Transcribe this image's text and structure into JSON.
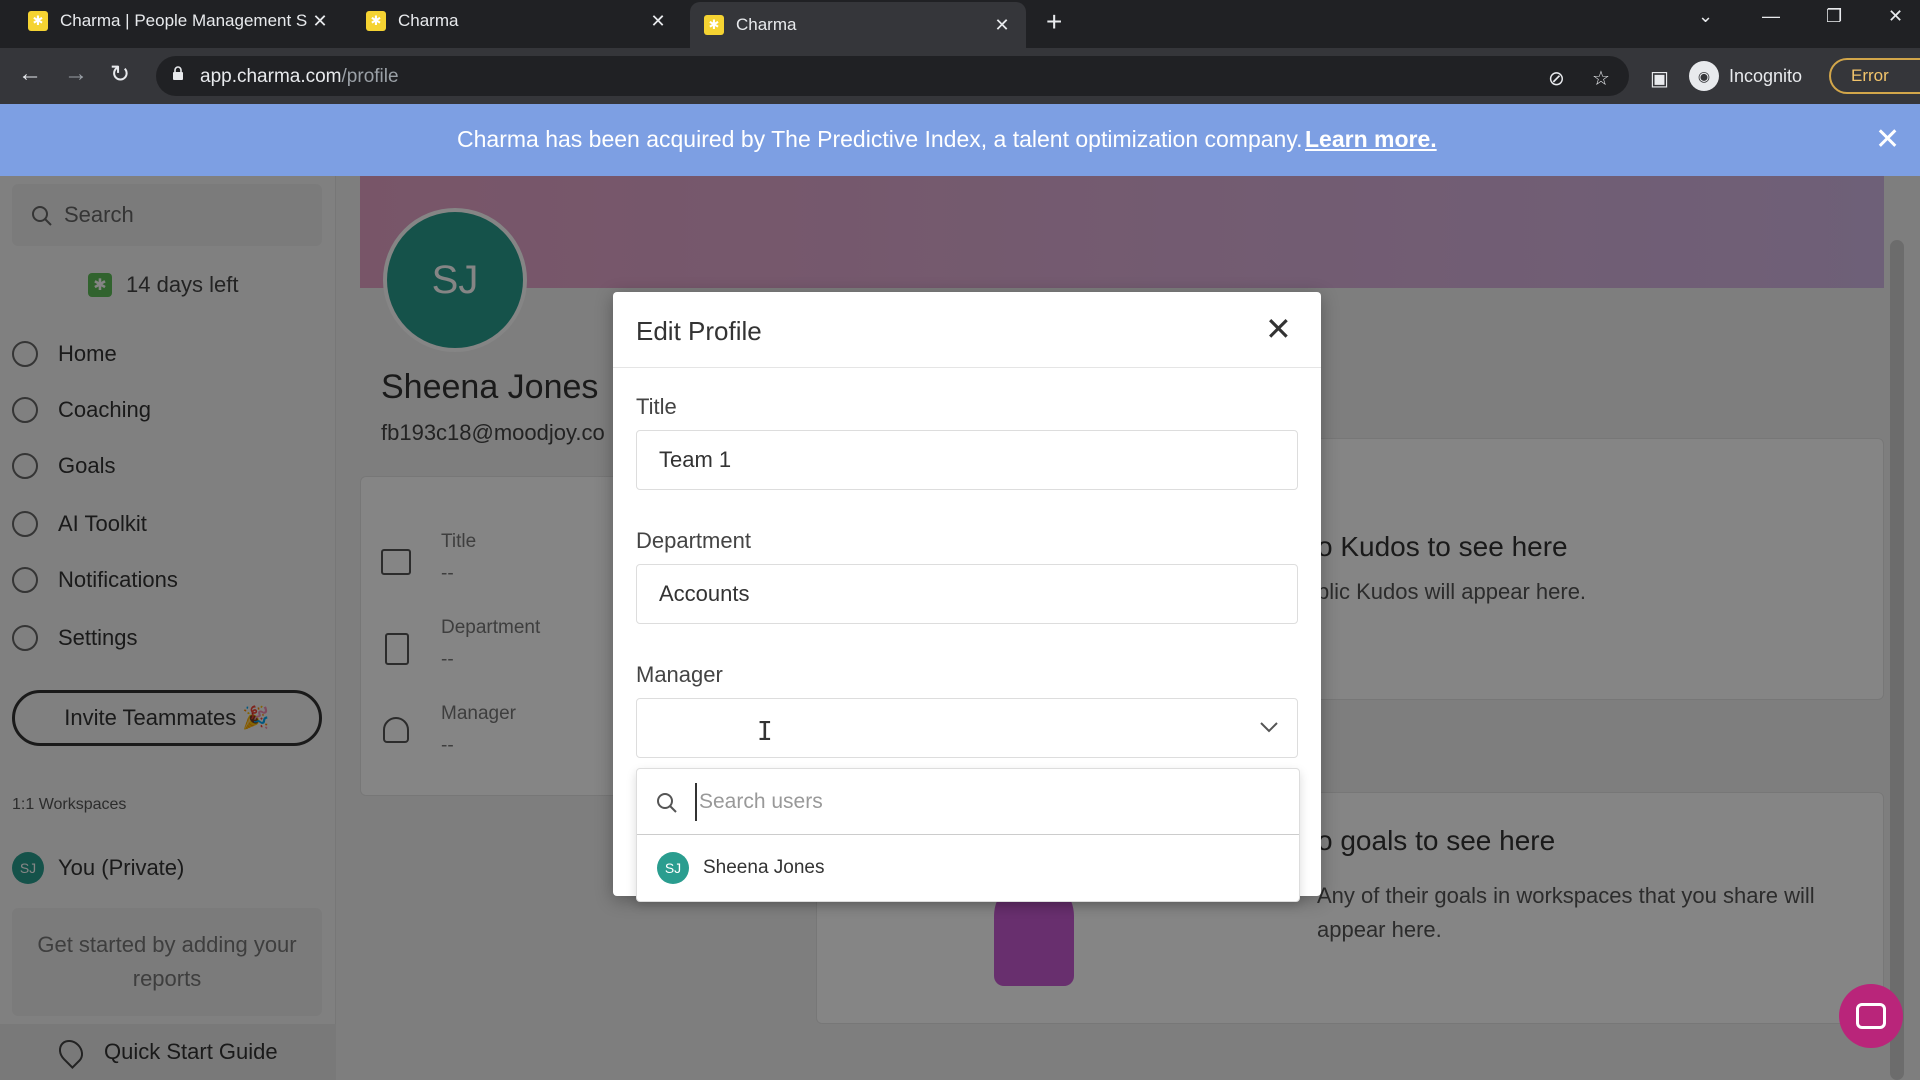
{
  "browser": {
    "tabs": [
      {
        "title": "Charma | People Management S"
      },
      {
        "title": "Charma"
      },
      {
        "title": "Charma"
      }
    ],
    "url_host": "app.charma.com",
    "url_path": "/profile",
    "incognito_label": "Incognito",
    "error_label": "Error"
  },
  "banner": {
    "message": "Charma has been acquired by The Predictive Index, a talent optimization company.",
    "link": "Learn more."
  },
  "sidebar": {
    "search_placeholder": "Search",
    "trial": "14 days left",
    "items": [
      {
        "label": "Home",
        "icon": "home-icon"
      },
      {
        "label": "Coaching",
        "icon": "coaching-icon"
      },
      {
        "label": "Goals",
        "icon": "goals-icon"
      },
      {
        "label": "AI Toolkit",
        "icon": "ai-toolkit-icon"
      },
      {
        "label": "Notifications",
        "icon": "bell-icon"
      },
      {
        "label": "Settings",
        "icon": "gear-icon"
      }
    ],
    "invite": "Invite Teammates 🎉",
    "workspaces_label": "1:1 Workspaces",
    "workspace": {
      "initials": "SJ",
      "label": "You (Private)"
    },
    "reports_hint": "Get started by adding your reports",
    "quick_start": "Quick Start Guide"
  },
  "profile": {
    "initials": "SJ",
    "name": "Sheena Jones",
    "email": "fb193c18@moodjoy.co",
    "fields": [
      {
        "label": "Title",
        "value": "--"
      },
      {
        "label": "Department",
        "value": "--"
      },
      {
        "label": "Manager",
        "value": "--"
      }
    ],
    "kudos_title": "o Kudos to see here",
    "kudos_sub": "blic Kudos will appear here.",
    "goals_title": "o goals to see here",
    "goals_sub": "Any of their goals in workspaces that you share will appear here."
  },
  "modal": {
    "title": "Edit Profile",
    "title_label": "Title",
    "title_value": "Team 1",
    "department_label": "Department",
    "department_value": "Accounts",
    "manager_label": "Manager",
    "manager_value": "",
    "search_placeholder": "Search users",
    "options": [
      {
        "initials": "SJ",
        "name": "Sheena Jones"
      }
    ]
  },
  "colors": {
    "banner": "#7d9fe3",
    "avatar": "#2a9d8f",
    "chat": "#b9257a"
  }
}
